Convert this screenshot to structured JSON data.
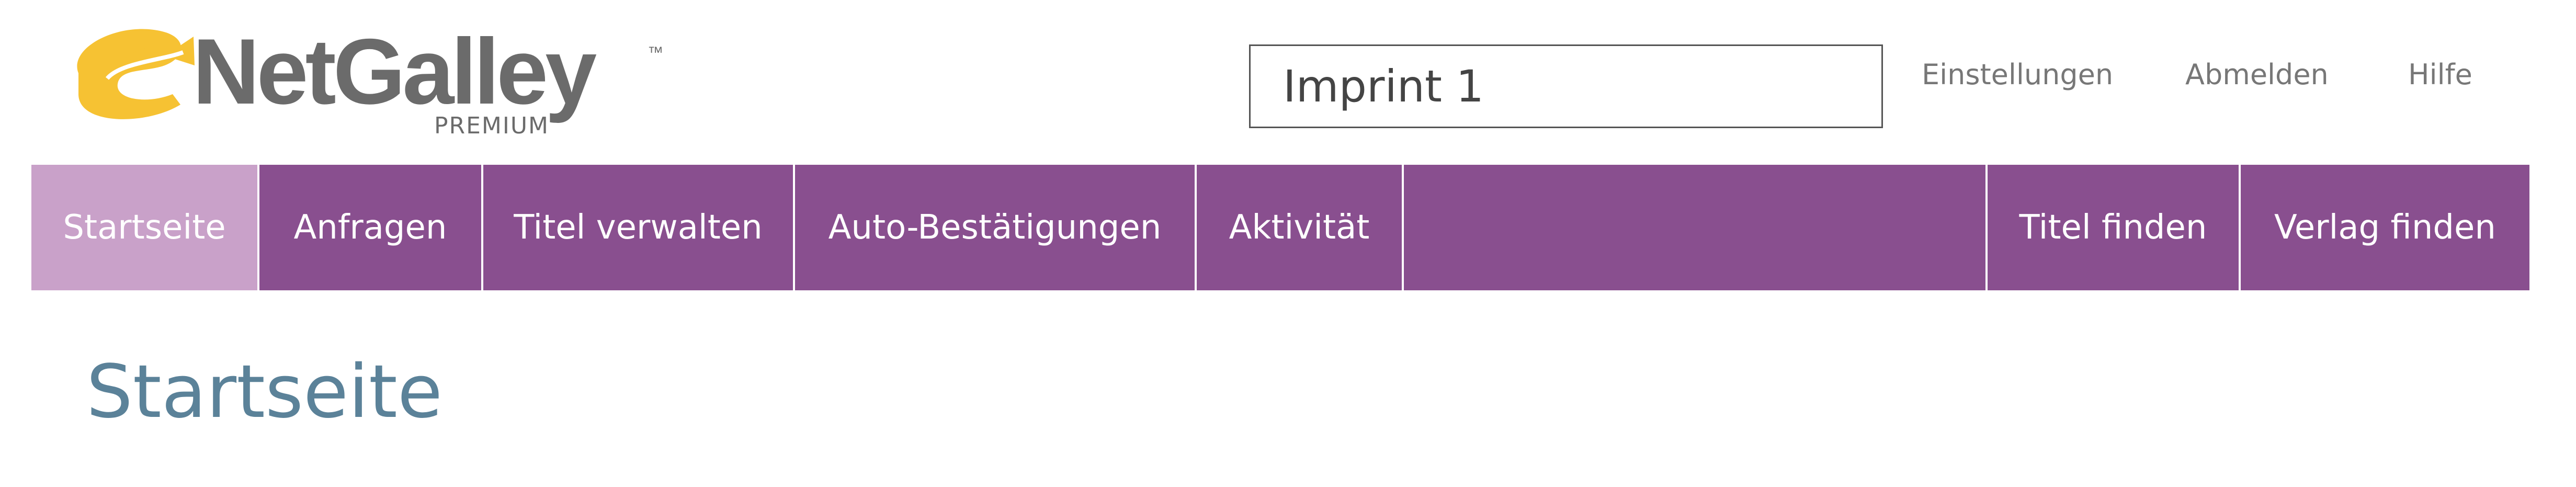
{
  "brand": {
    "name": "NetGalley",
    "tier": "PREMIUM",
    "trademark": "™",
    "colors": {
      "logo_text": "#6b6b6b",
      "logo_accent": "#f6c233"
    }
  },
  "header": {
    "imprint_selector": "Imprint 1",
    "links": {
      "settings": "Einstellungen",
      "logout": "Abmelden",
      "help": "Hilfe"
    }
  },
  "nav": {
    "items": [
      {
        "label": "Startseite",
        "active": true
      },
      {
        "label": "Anfragen",
        "active": false
      },
      {
        "label": "Titel verwalten",
        "active": false
      },
      {
        "label": "Auto-Bestätigungen",
        "active": false
      },
      {
        "label": "Aktivität",
        "active": false
      }
    ],
    "right_items": [
      {
        "label": "Titel finden"
      },
      {
        "label": "Verlag finden"
      }
    ],
    "colors": {
      "bar": "#894f8f",
      "active": "#c9a1c9",
      "text": "#ffffff"
    }
  },
  "main": {
    "title": "Startseite",
    "title_color": "#5b8299"
  }
}
